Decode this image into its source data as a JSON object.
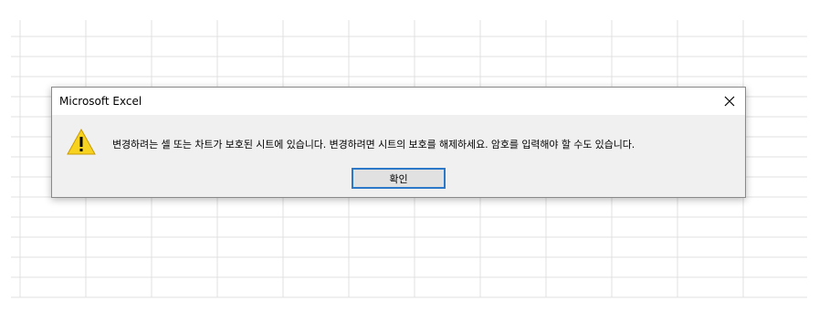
{
  "dialog": {
    "title": "Microsoft Excel",
    "message": "변경하려는 셀 또는 차트가 보호된 시트에 있습니다. 변경하려면 시트의 보호를 해제하세요. 암호를 입력해야 할 수도 있습니다.",
    "ok_label": "확인",
    "icon": "warning-icon",
    "close_icon": "close-icon"
  },
  "colors": {
    "button_focus_border": "#2b78c8",
    "dialog_background": "#f0f0f0",
    "warning_fill": "#f7d21f"
  }
}
